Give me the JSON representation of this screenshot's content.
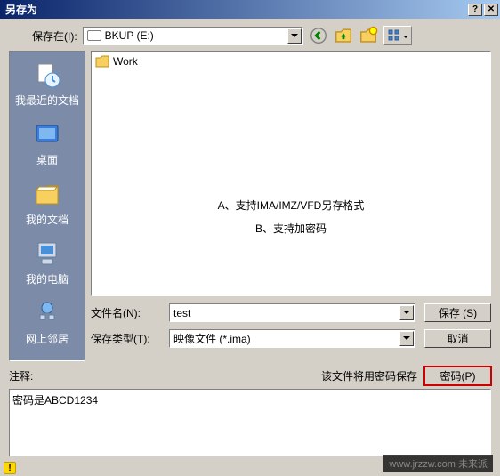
{
  "title": "另存为",
  "save_in_label": "保存在(I):",
  "drive": "BKUP (E:)",
  "sidebar": {
    "items": [
      {
        "label": "我最近的文档"
      },
      {
        "label": "桌面"
      },
      {
        "label": "我的文档"
      },
      {
        "label": "我的电脑"
      },
      {
        "label": "网上邻居"
      }
    ]
  },
  "filelist": {
    "folder": "Work",
    "hint_a": "A、支持IMA/IMZ/VFD另存格式",
    "hint_b": "B、支持加密码"
  },
  "filename_label": "文件名(N):",
  "filename_value": "test",
  "filetype_label": "保存类型(T):",
  "filetype_value": "映像文件 (*.ima)",
  "save_btn": "保存 (S)",
  "cancel_btn": "取消",
  "notes_label": "注释:",
  "notes_hint": "该文件将用密码保存",
  "password_btn": "密码(P)",
  "notes_text": "密码是ABCD1234",
  "watermark": "www.jrzzw.com 未来派"
}
